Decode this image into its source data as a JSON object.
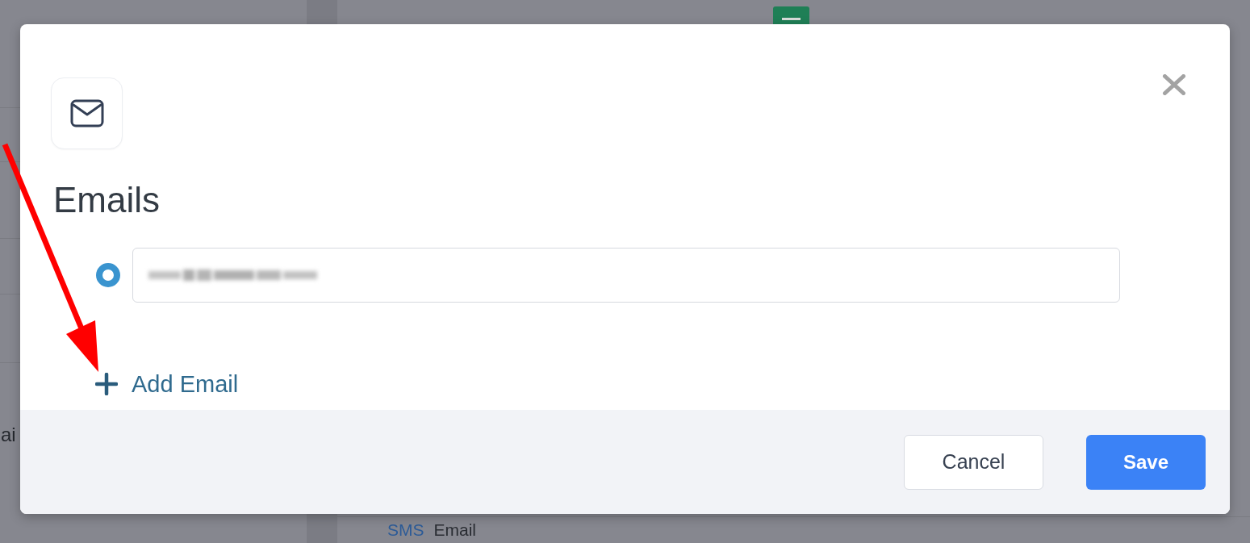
{
  "background": {
    "side_text": "ai",
    "bottom_links": [
      {
        "label": "SMS",
        "kind": "link"
      },
      {
        "label": "Email",
        "kind": "text"
      }
    ]
  },
  "dialog": {
    "title": "Emails",
    "emails": [
      {
        "selected": true,
        "value_redacted": true
      }
    ],
    "add_link": "Add Email",
    "buttons": [
      {
        "label": "Cancel",
        "kind": "secondary"
      },
      {
        "label": "Save",
        "kind": "primary"
      }
    ]
  }
}
